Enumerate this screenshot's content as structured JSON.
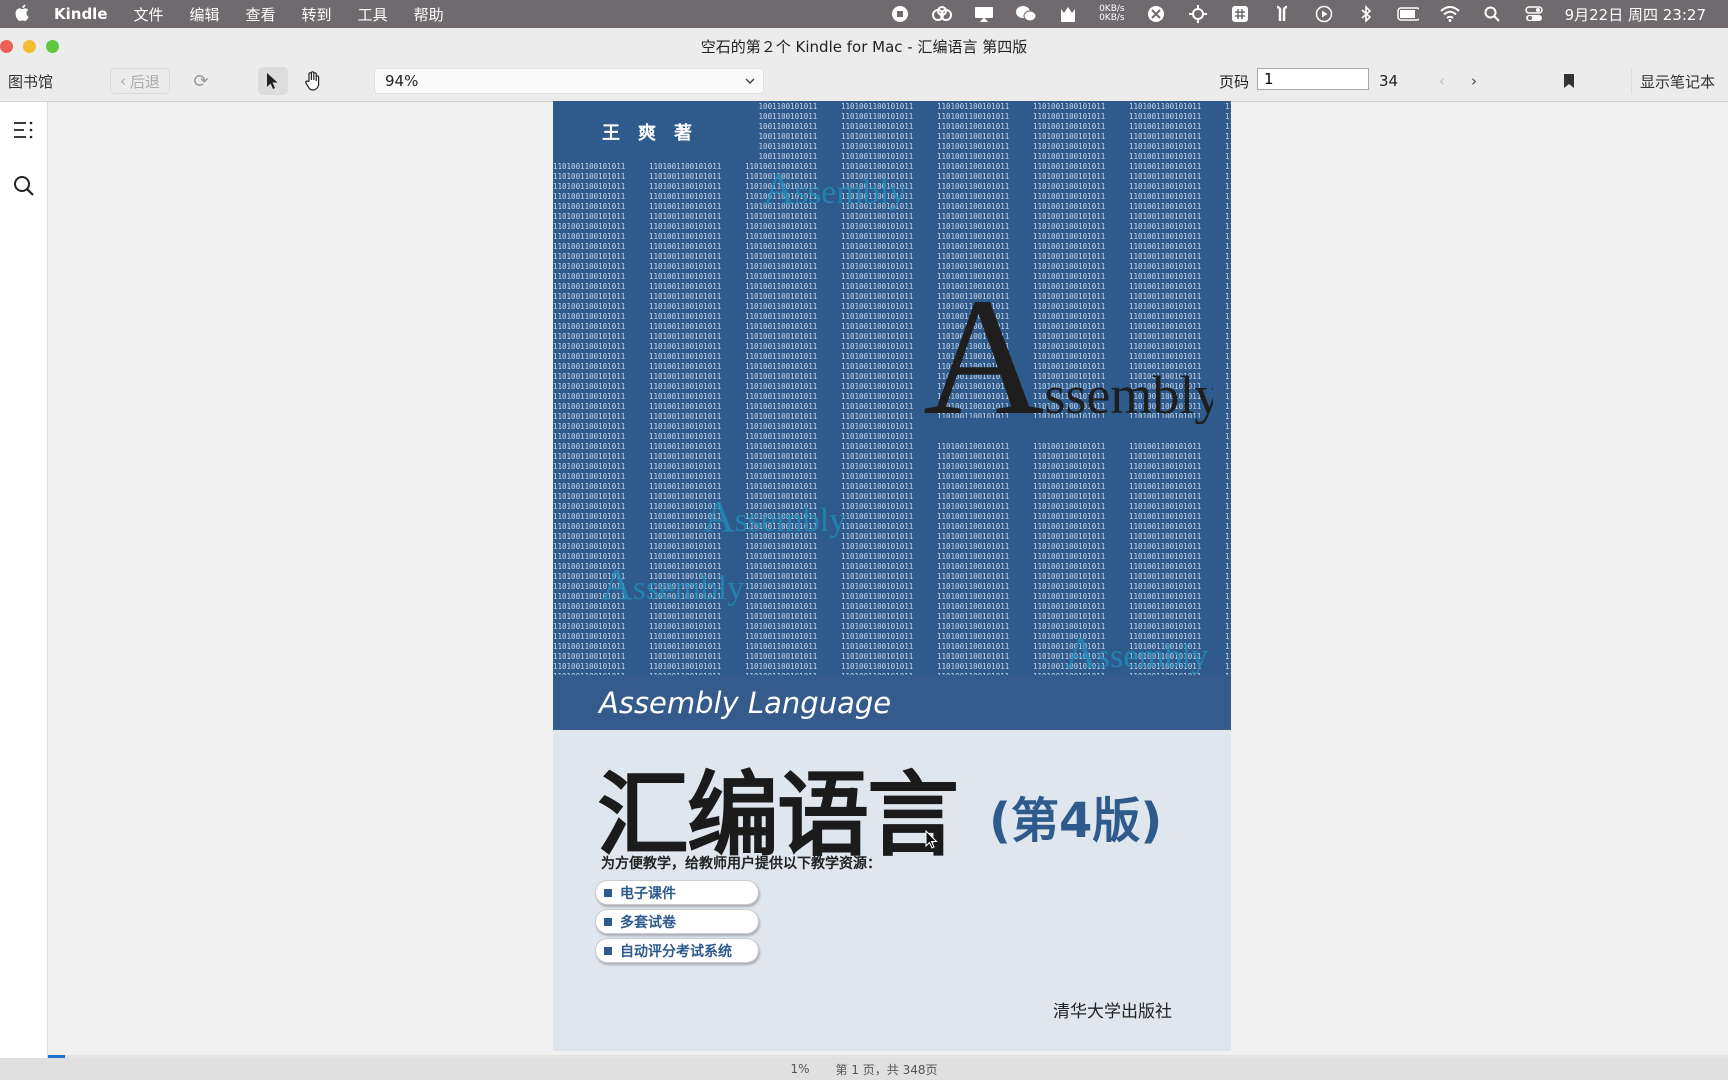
{
  "menubar": {
    "app_name": "Kindle",
    "menus": [
      "文件",
      "编辑",
      "查看",
      "转到",
      "工具",
      "帮助"
    ],
    "net_up": "0KB/s",
    "net_down": "0KB/s",
    "clock": "9月22日 周四 23:27"
  },
  "window": {
    "title": "空石的第２个 Kindle for Mac - 汇编语言 第四版"
  },
  "toolbar": {
    "library_label": "图书馆",
    "back_label": "后退",
    "zoom_value": "94%",
    "page_label": "页码",
    "page_value": "1",
    "page_total": "34",
    "notes_label": "显示笔记本"
  },
  "cover": {
    "author": "王爽著",
    "big_word": "Assembly",
    "faint_word": "Assembly",
    "lang_label": "Assembly Language",
    "title": "汇编语言",
    "edition": "(第4版)",
    "resources_note": "为方便教学，给教师用户提供以下教学资源：",
    "resources": [
      "电子课件",
      "多套试卷",
      "自动评分考试系统"
    ],
    "publisher": "清华大学出版社",
    "colors": {
      "blue": "#2f5a8c",
      "light": "#dfe6ee"
    }
  },
  "status": {
    "progress_percent": 1,
    "progress_label": "1%",
    "page_info": "第 1 页，共 348页"
  }
}
